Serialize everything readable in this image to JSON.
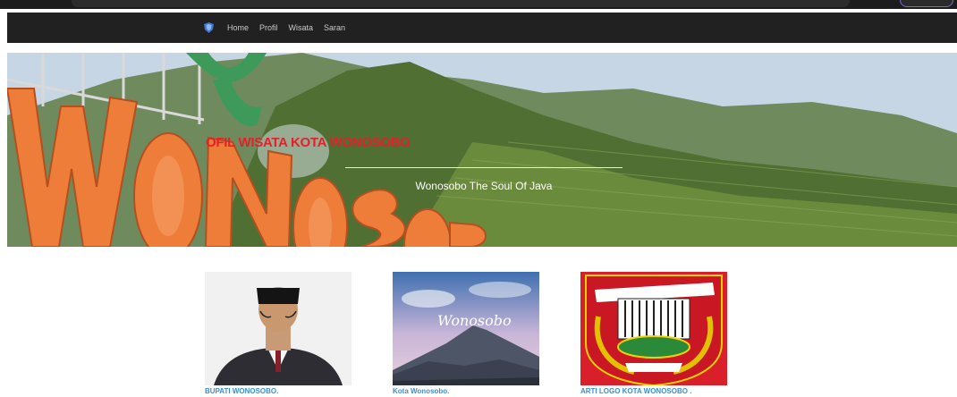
{
  "navbar": {
    "brand_icon": "shield-icon",
    "links": [
      "Home",
      "Profil",
      "Wisata",
      "Saran"
    ]
  },
  "hero": {
    "title": "OFIL WISATA KOTA WONOSOBO",
    "tagline": "Wonosobo The Soul Of Java",
    "sign_text": "WONOSOBO"
  },
  "cards": [
    {
      "caption": "BUPATI WONOSOBO."
    },
    {
      "caption": "Kota Wonosobo.",
      "image_text": "Wonosobo"
    },
    {
      "caption": "ARTI LOGO KOTA WONOSOBO ."
    }
  ],
  "colors": {
    "navbar_bg": "#212121",
    "title_red": "#e4202a",
    "caption_blue": "#3b8fd0"
  }
}
